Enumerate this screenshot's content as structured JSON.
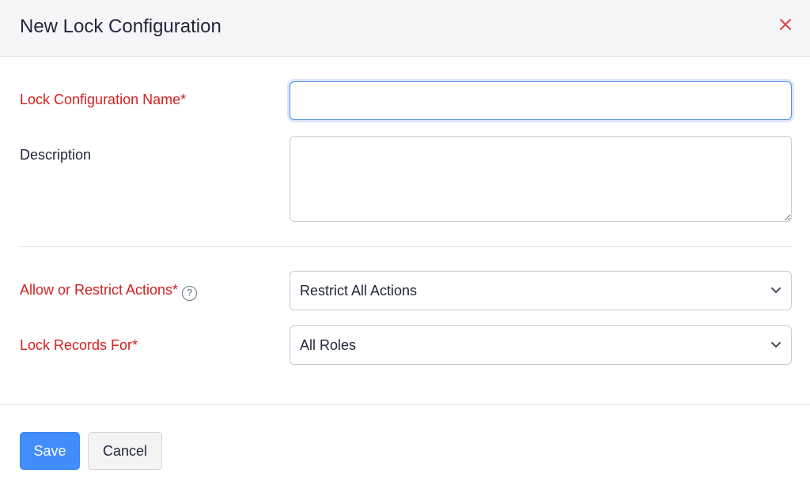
{
  "dialog": {
    "title": "New Lock Configuration",
    "close_icon": "close-icon"
  },
  "form": {
    "name": {
      "label": "Lock Configuration Name*",
      "value": "",
      "placeholder": ""
    },
    "description": {
      "label": "Description",
      "value": "",
      "placeholder": ""
    },
    "actions": {
      "label": "Allow or Restrict Actions*",
      "help_icon": "question-circle-icon",
      "help_glyph": "?",
      "selected": "Restrict All Actions"
    },
    "lock_for": {
      "label": "Lock Records For*",
      "selected": "All Roles"
    }
  },
  "footer": {
    "save_label": "Save",
    "cancel_label": "Cancel"
  },
  "colors": {
    "required_label": "#d41f1f",
    "primary_button": "#408dfb",
    "close_icon": "#e04a4a",
    "focus_border": "#5a8fe0"
  }
}
